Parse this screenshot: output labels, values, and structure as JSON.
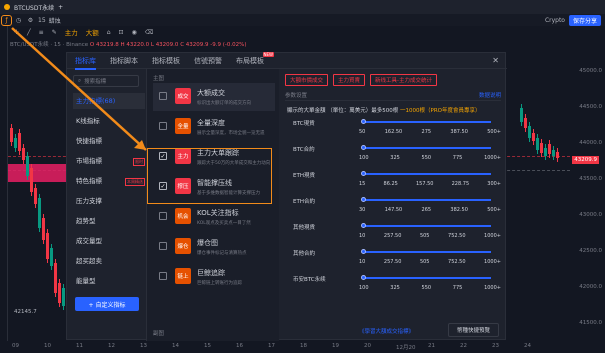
{
  "header": {
    "symbol": "BTCUSDT永续",
    "plus": "+"
  },
  "toolbar": {
    "interval": "15",
    "chart_type": "蜡烛",
    "indicators_label": "主力",
    "big_deal_label": "大额",
    "accent_color": "#f7a600"
  },
  "topright": {
    "crypto_label": "Crypto",
    "share_label": "保存分享"
  },
  "indicator_line": {
    "prefix": "BTC/USDT永续 · 15 · Binance",
    "o": "O 43219.8",
    "h": "H 43220.0",
    "l": "L 43209.0",
    "c": "C 43209.9",
    "chg": "-9.9 (-0.02%)"
  },
  "chart": {
    "price_tag": "43209.9",
    "low_label": "42145.7",
    "y_ticks": [
      "45000.0",
      "44500.0",
      "44000.0",
      "43500.0",
      "43000.0",
      "42500.0",
      "42000.0",
      "41500.0"
    ],
    "x_ticks": [
      "09",
      "10",
      "11",
      "12",
      "13",
      "14",
      "15",
      "16",
      "17",
      "18",
      "19",
      "20",
      "12月20",
      "21",
      "22",
      "23",
      "24"
    ]
  },
  "modal": {
    "tabs": [
      {
        "label": "指标库",
        "active": true
      },
      {
        "label": "指标脚本",
        "active": false
      },
      {
        "label": "指标模板",
        "active": false
      },
      {
        "label": "信號預警",
        "active": false
      },
      {
        "label": "布局模板",
        "active": false,
        "badge": "NEW"
      }
    ],
    "search_placeholder": "搜索指標",
    "categories": [
      {
        "label": "主力指標(68)",
        "active": true
      },
      {
        "label": "K线指标",
        "active": false
      },
      {
        "label": "快捷指標",
        "active": false
      },
      {
        "label": "市場指標",
        "active": false,
        "badge": "限时"
      },
      {
        "label": "特色指標",
        "active": false,
        "badge": "本周精选"
      },
      {
        "label": "压力支撑",
        "active": false
      },
      {
        "label": "趋势型",
        "active": false
      },
      {
        "label": "成交量型",
        "active": false
      },
      {
        "label": "超买超卖",
        "active": false
      },
      {
        "label": "能量型",
        "active": false
      }
    ],
    "add_button": "+ 自定义指标",
    "mid_header": "主图",
    "mid_footer": "副图",
    "items": [
      {
        "tag": "成交",
        "name": "大额成交",
        "desc": "标识出大额订单的成交方向",
        "checked": false,
        "color": "#f23645",
        "selected": true
      },
      {
        "tag": "全量",
        "name": "全量深度",
        "desc": "展示全量深度，市场全貌一览无遗",
        "checked": false,
        "color": "#e65100",
        "selected": false
      },
      {
        "tag": "主力",
        "name": "主力大单跟踪",
        "desc": "跟踪大于50万的大单成交和主力动向",
        "checked": true,
        "color": "#f23645",
        "selected": false
      },
      {
        "tag": "撑压",
        "name": "智能撑压线",
        "desc": "基于多维数据智能计算支撑压力",
        "checked": true,
        "color": "#f23645",
        "selected": false
      },
      {
        "tag": "机会",
        "name": "KOL关注指标",
        "desc": "KOL观点及买卖点一目了然",
        "checked": false,
        "color": "#e65100",
        "selected": false
      },
      {
        "tag": "爆仓",
        "name": "爆仓图",
        "desc": "爆仓事件标记与清算热点",
        "checked": false,
        "color": "#e65100",
        "selected": false
      },
      {
        "tag": "链上",
        "name": "巨鲸追踪",
        "desc": "巨鲸链上转账行为追踪",
        "checked": false,
        "color": "#e65100",
        "selected": false
      }
    ],
    "pills": [
      "大額市價成交",
      "主力買賣",
      "新线工具-主力成交统计"
    ],
    "param_header": "参数设置",
    "param_link": "数据说明",
    "param_sub": "顯示的大單金額",
    "param_unit": "（單位：萬美元）最多500根",
    "param_note": "一1000根（PRO年度會員專享）",
    "rows": [
      {
        "label": "BTC現貨",
        "values": [
          "50",
          "162.50",
          "275",
          "387.50",
          "500+"
        ],
        "knob": 0.0
      },
      {
        "label": "BTC合約",
        "values": [
          "100",
          "325",
          "550",
          "775",
          "1000+"
        ],
        "knob": 0.0
      },
      {
        "label": "ETH現貨",
        "values": [
          "15",
          "86.25",
          "157.50",
          "228.75",
          "300+"
        ],
        "knob": 0.0
      },
      {
        "label": "ETH合約",
        "values": [
          "30",
          "147.50",
          "265",
          "382.50",
          "500+"
        ],
        "knob": 0.0
      },
      {
        "label": "其他現貨",
        "values": [
          "10",
          "257.50",
          "505",
          "752.50",
          "1000+"
        ],
        "knob": 0.0
      },
      {
        "label": "其他合約",
        "values": [
          "10",
          "257.50",
          "505",
          "752.50",
          "1000+"
        ],
        "knob": 0.0
      },
      {
        "label": "币安BTC永续",
        "values": [
          "100",
          "325",
          "550",
          "775",
          "1000+"
        ],
        "knob": 0.0
      }
    ],
    "footer_link": "《學習大額成交指標》",
    "footer_button": "幣種快捷預覽"
  }
}
